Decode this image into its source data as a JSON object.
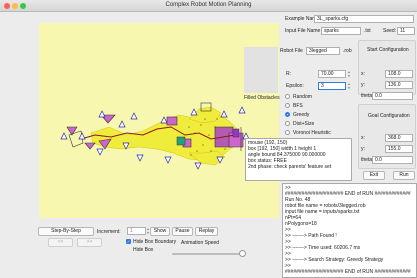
{
  "window": {
    "title": "Complex Robot Motion Planning"
  },
  "header": {
    "example_label": "Example Name",
    "example_value": "3L_sparks.cfg",
    "input_label": "Input File Name",
    "input_value": "sparks",
    "input_ext": ".txt",
    "seed_label": "Seed:",
    "seed_value": "11"
  },
  "robot": {
    "file_label": "Robot File",
    "file_value": "3legged",
    "file_ext": ".rob",
    "r_label": "R:",
    "r_value": "70.00",
    "eps_label": "Epsilon:",
    "eps_value": "3",
    "filled_obstacles": "Filled Obstacles"
  },
  "strategy": {
    "options": [
      "Random",
      "BFS",
      "Greedy",
      "Dist+Size",
      "Voronoi Heuristic"
    ],
    "selected": "Greedy"
  },
  "start_config": {
    "title": "Start Configuration",
    "x_label": "x:",
    "x_value": "108.0",
    "y_label": "y:",
    "y_value": "136.0",
    "theta_label": "theta:",
    "theta_value": "0.0"
  },
  "goal_config": {
    "title": "Goal Configuration",
    "x_label": "x:",
    "x_value": "368.0",
    "y_label": "y:",
    "y_value": "155.0",
    "theta_label": "theta:",
    "theta_value": "0.0"
  },
  "actions": {
    "exit": "Exit",
    "run": "Run"
  },
  "info_lines": [
    "mouse (192, 150)",
    "box [192, 150] width 1 height 1",
    "angle bound 84.375000 90.000000",
    "box status: FREE",
    "2nd phase: check parents' feature set"
  ],
  "console_lines": [
    ">>",
    "##################### END of RUN #############",
    "Run No. 48",
    "robot file name = robots/3legged.rob",
    "input file name = inputs/sparks.txt",
    "nPt=64",
    "nPolygons=18",
    ">>",
    ">>         -------> Path Found !",
    ">>",
    ">>         -------> Time used: 60206.7 ms",
    ">>",
    ">>         -------> Search Strategy: Greedy Strategy",
    ">>",
    "##################### END of RUN #############"
  ],
  "controls": {
    "step_label": "Step-By-Step",
    "increment_label": "Increment:",
    "increment_value": "1",
    "show": "Show",
    "pause": "Pause",
    "replay": "Replay",
    "prev": "<<",
    "next": ">>",
    "hide_box_boundary": "Hide Box Boundary",
    "hide_box": "Hide Box",
    "animation_speed_label": "Animation Speed",
    "animation_speed": 1.0
  },
  "colors": {
    "canvas_bg": "#f8f7b0",
    "obstacle_fill": "#cc66cc",
    "obstacle_stroke": "#333333",
    "free_space": "#f0ec3c",
    "path": "#8b1a1a",
    "start_marker": "#1fa37a",
    "goal_marker": "#9933cc",
    "triangle_stroke": "#2a2ab0",
    "accent": "#2f7ce0"
  }
}
